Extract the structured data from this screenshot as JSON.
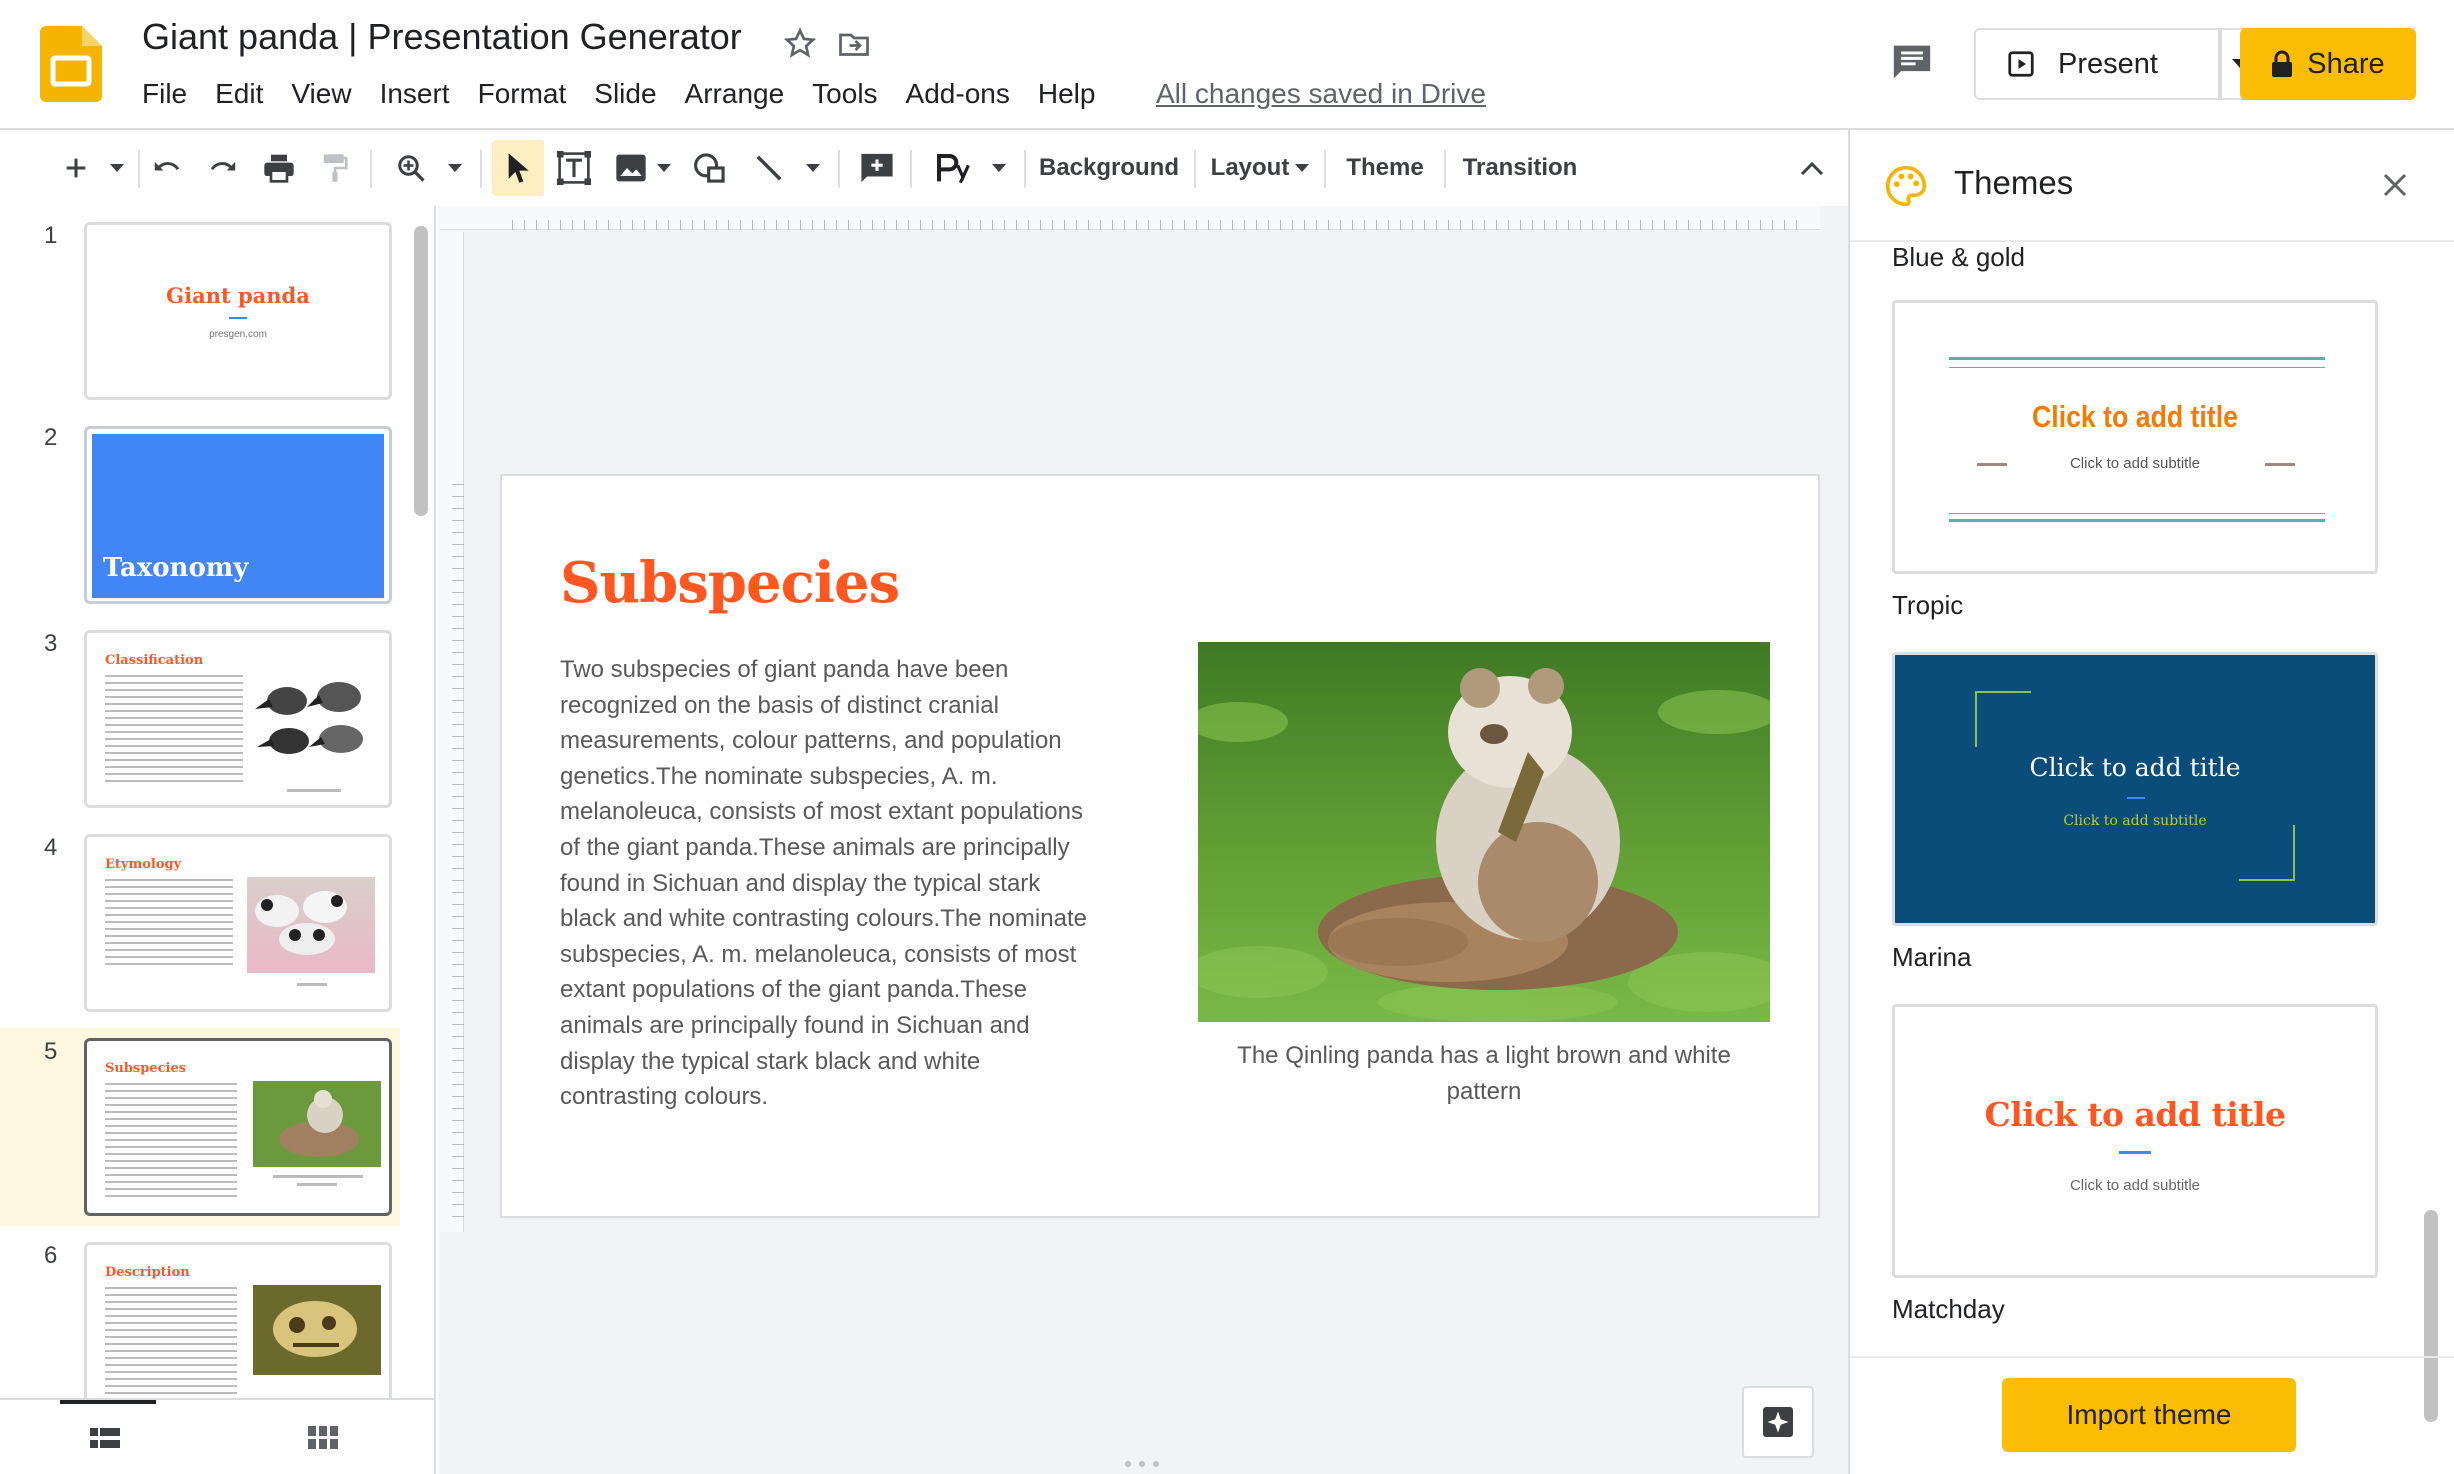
{
  "app": {
    "title": "Giant panda | Presentation Generator",
    "save_status": "All changes saved in Drive",
    "present_label": "Present",
    "share_label": "Share"
  },
  "menu": [
    "File",
    "Edit",
    "View",
    "Insert",
    "Format",
    "Slide",
    "Arrange",
    "Tools",
    "Add-ons",
    "Help"
  ],
  "toolbar": {
    "background": "Background",
    "layout": "Layout",
    "theme": "Theme",
    "transition": "Transition"
  },
  "filmstrip": {
    "selected": 5,
    "slides": [
      {
        "num": "1",
        "title": "Giant panda",
        "subtitle": "presgen.com"
      },
      {
        "num": "2",
        "title": "Taxonomy"
      },
      {
        "num": "3",
        "title": "Classification"
      },
      {
        "num": "4",
        "title": "Etymology"
      },
      {
        "num": "5",
        "title": "Subspecies"
      },
      {
        "num": "6",
        "title": "Description"
      }
    ]
  },
  "slide": {
    "title": "Subspecies",
    "body": "Two subspecies of giant panda have been recognized on the basis of distinct cranial measurements, colour patterns, and population genetics.The  nominate subspecies, A. m. melanoleuca, consists of most extant populations of the giant panda.These  animals are principally found in Sichuan and display the typical stark black and white contrasting colours.The  nominate subspecies, A. m. melanoleuca, consists of most extant populations of the giant panda.These  animals are principally found in Sichuan and display the typical stark black and white contrasting colours.",
    "caption": "The Qinling panda has a light brown and white pattern"
  },
  "themes": {
    "title": "Themes",
    "sections": [
      {
        "name": "Blue & gold"
      },
      {
        "name": "Tropic",
        "card_title": "Click to add title",
        "card_subtitle": "Click to add subtitle"
      },
      {
        "name": "Marina",
        "card_title": "Click to add title",
        "card_subtitle": "Click to add subtitle"
      },
      {
        "name": "Matchday",
        "card_title": "Click to add title",
        "card_subtitle": "Click to add subtitle"
      }
    ],
    "import_label": "Import theme"
  },
  "colors": {
    "accent": "#fbbc04",
    "slide_title": "#ff5722",
    "marina": "#0b4d7a",
    "selection": "#fef7e0"
  }
}
